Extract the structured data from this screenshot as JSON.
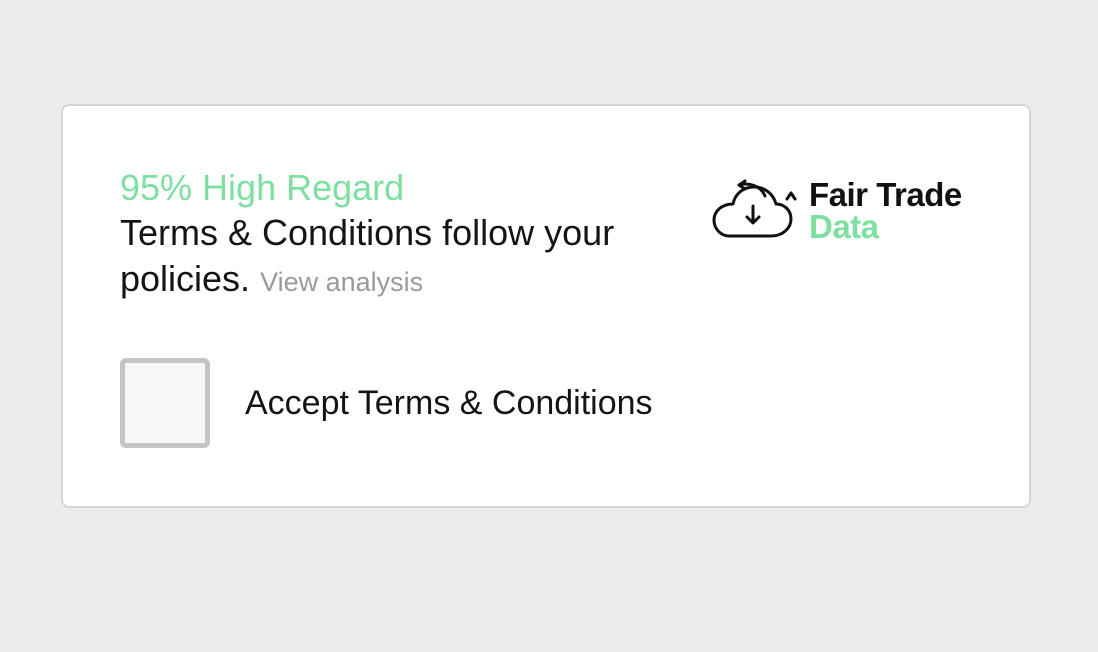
{
  "header": {
    "rating": "95% High Regard",
    "message": "Terms & Conditions follow your policies.",
    "view_link": "View analysis"
  },
  "brand": {
    "line1": "Fair Trade",
    "line2": "Data",
    "icon": "cloud-sync-icon"
  },
  "accept": {
    "label": "Accept Terms & Conditions",
    "checked": false
  },
  "colors": {
    "accent": "#7de0a0",
    "text": "#141414",
    "muted": "#9a9a9a",
    "background": "#ececec",
    "card": "#ffffff",
    "checkbox_border": "#c4c4c4"
  }
}
